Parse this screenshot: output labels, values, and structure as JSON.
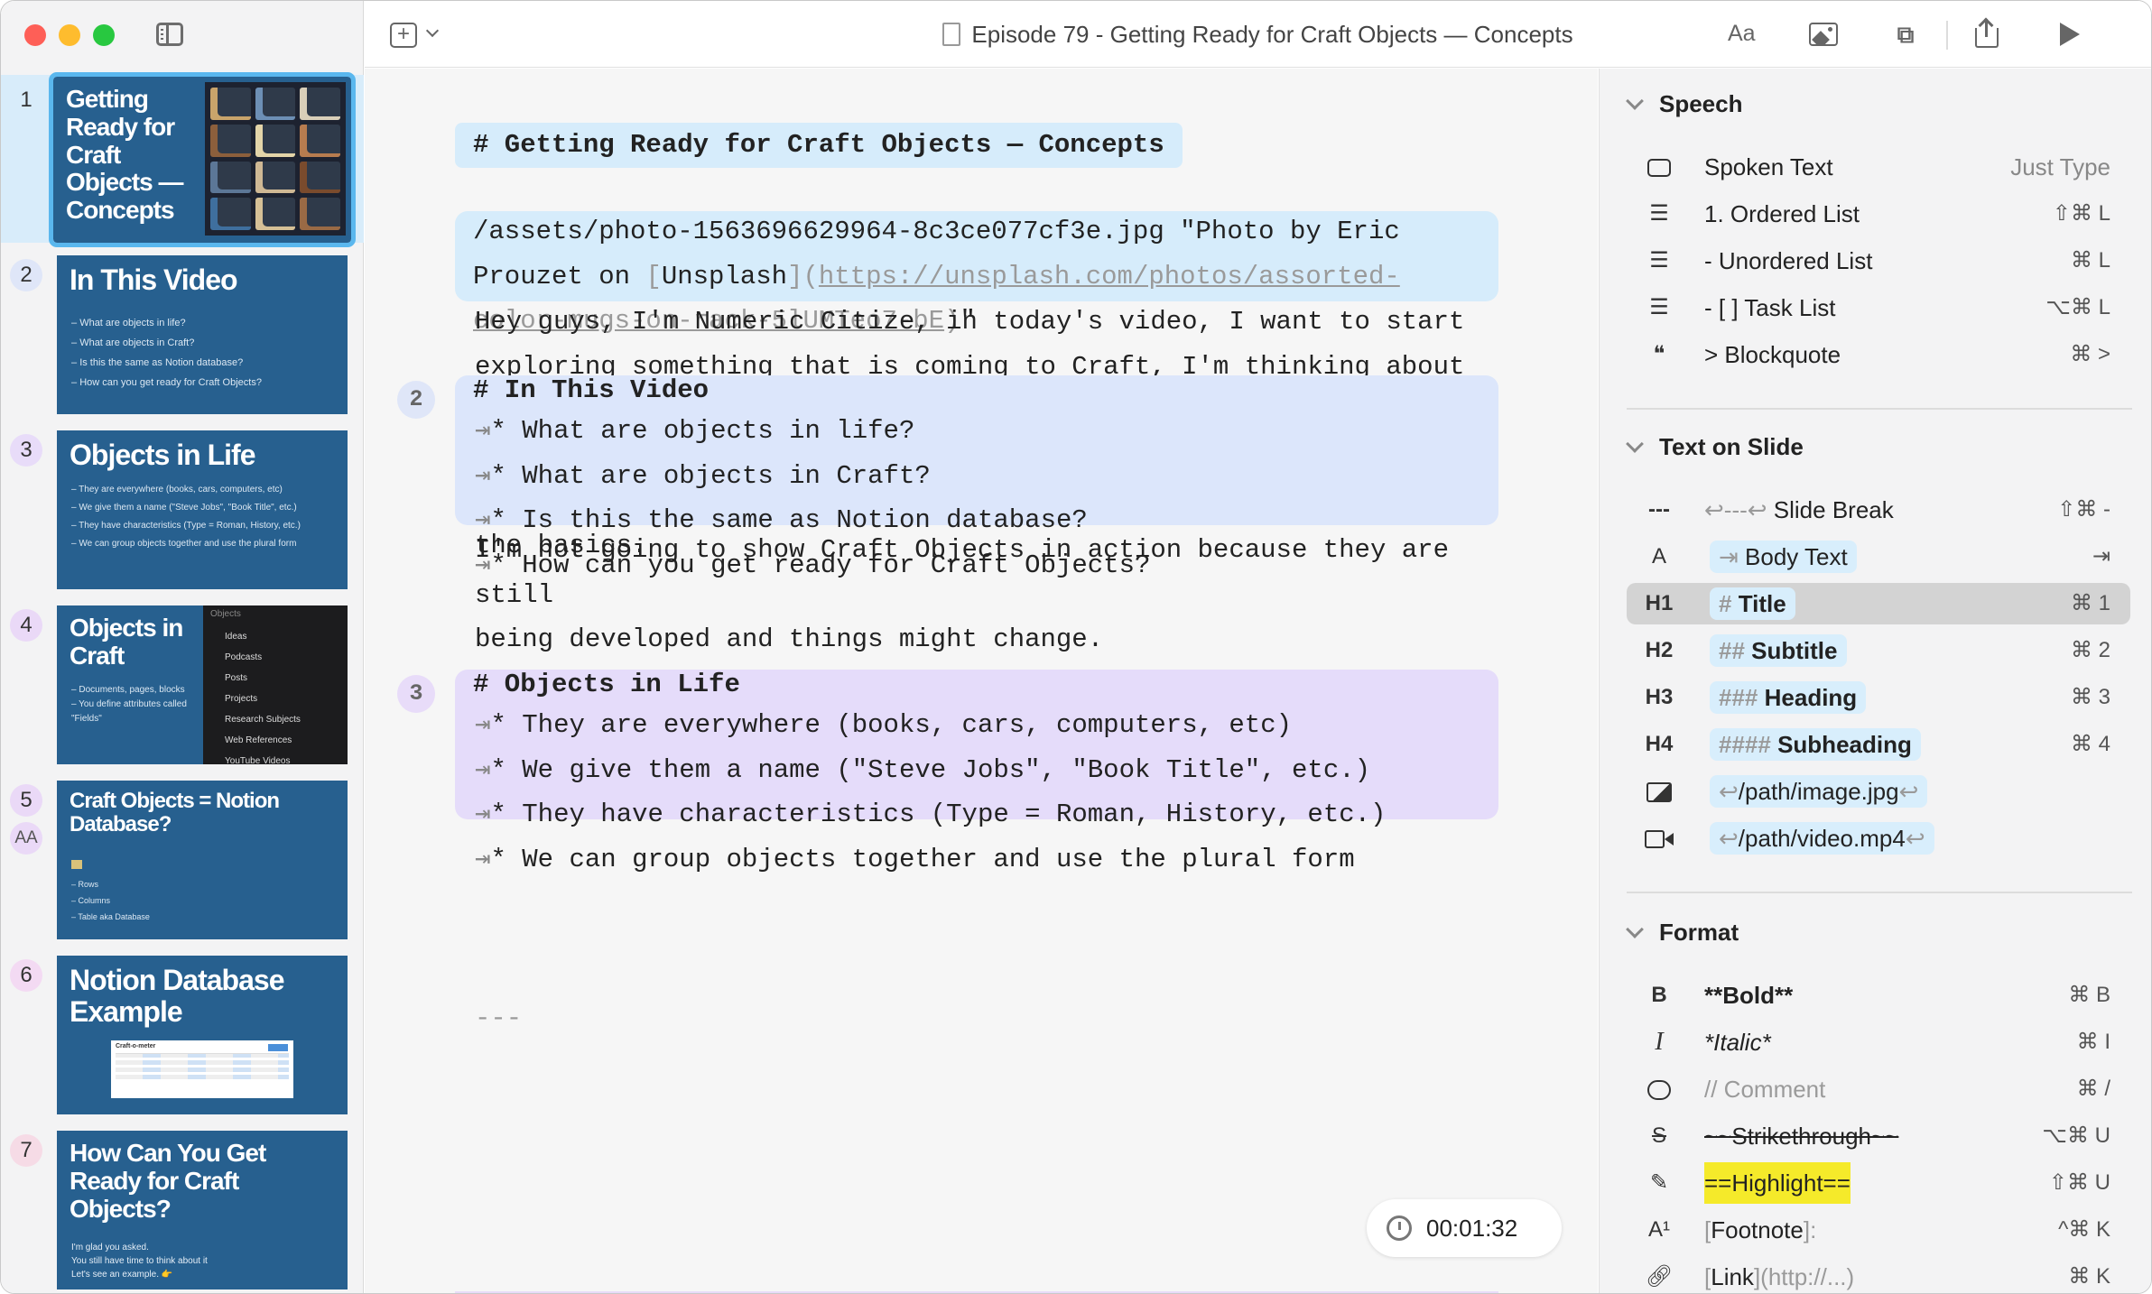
{
  "window": {
    "title": "Episode 79 - Getting Ready for Craft Objects — Concepts"
  },
  "slides": [
    {
      "num": "1",
      "title": "Getting Ready for Craft Objects — Concepts",
      "bullets": []
    },
    {
      "num": "2",
      "title": "In This Video",
      "bullets": [
        "What are objects in life?",
        "What are objects in Craft?",
        "Is this the same as Notion database?",
        "How can you get ready for Craft Objects?"
      ]
    },
    {
      "num": "3",
      "title": "Objects in Life",
      "bullets": [
        "They are everywhere (books, cars, computers, etc)",
        "We give them a name (\"Steve Jobs\", \"Book Title\", etc.)",
        "They have characteristics (Type = Roman, History, etc.)",
        "We can group objects together and use the plural form"
      ]
    },
    {
      "num": "4",
      "title": "Objects in Craft",
      "bullets": [
        "Documents, pages, blocks",
        "You define attributes called \"Fields\""
      ],
      "side_header": "Objects",
      "side_items": [
        "Ideas",
        "Podcasts",
        "Posts",
        "Projects",
        "Research Subjects",
        "Web References",
        "YouTube Videos"
      ]
    },
    {
      "num": "5",
      "title": "Craft Objects = Notion Database?",
      "bullets": [
        "Rows",
        "Columns",
        "Table aka Database"
      ],
      "badge": "AA"
    },
    {
      "num": "6",
      "title": "Notion Database Example",
      "bullets": [],
      "inner_title": "Craft-o-meter"
    },
    {
      "num": "7",
      "title": "How Can You Get Ready for Craft Objects?",
      "lines": [
        "I'm glad you asked.",
        "You still have time to think about it",
        "Let's see an example. 👉"
      ]
    }
  ],
  "editor": {
    "heading1": "# Getting Ready for Craft Objects — Concepts",
    "image_line_a": "/assets/photo-1563696629964-8c3ce077cf3e.jpg \"Photo by Eric",
    "image_line_b": "Prouzet on ",
    "image_link_text": "Unsplash",
    "image_url_a": "https://unsplash.com/photos/assorted-",
    "image_url_b": "color-mugs-on-rack-5lUMTeo7-bE",
    "image_line_c": "\"",
    "para1": "Hey guys, I'm Numeric Citize, in today's video, I want to start\nexploring something that is coming to Craft, I'm thinking about Craft\nObjects. There is so much to talk about. But first, let's start with\nthe basics.",
    "break": "---",
    "s2_num": "2",
    "s2_title": "# In This Video",
    "s2_items": [
      "* What are objects in life?",
      "* What are objects in Craft?",
      "* Is this the same as Notion database?",
      "* How can you get ready for Craft Objects?"
    ],
    "para2": "I'm not going to show Craft Objects in action because they are still\nbeing developed and things might change.\n\nIf you are a Notion user, I'll try to make a brief comparison",
    "s3_num": "3",
    "s3_title": "# Objects in Life",
    "s3_items": [
      "* They are everywhere (books, cars, computers, etc)",
      "* We give them a name (\"Steve Jobs\", \"Book Title\", etc.)",
      "* They have characteristics (Type = Roman, History, etc.)",
      "* We can group objects together and use the plural form"
    ],
    "tab_glyph": "⇥",
    "timer": "00:01:32"
  },
  "panel": {
    "speech": {
      "title": "Speech",
      "rows": [
        {
          "label": "Spoken Text",
          "shortcut": "Just Type"
        },
        {
          "label": "1. Ordered List",
          "shortcut": "⇧⌘ L"
        },
        {
          "label": "- Unordered List",
          "shortcut": "⌘ L"
        },
        {
          "label": "- [ ] Task List",
          "shortcut": "⌥⌘ L"
        },
        {
          "label": "> Blockquote",
          "shortcut": "⌘ >"
        }
      ]
    },
    "text_on_slide": {
      "title": "Text on Slide",
      "rows": [
        {
          "icon": "---",
          "pre": "↩---↩",
          "label": "Slide Break",
          "shortcut": "⇧⌘ -"
        },
        {
          "icon": "A",
          "pre": "⇥",
          "label": "Body Text",
          "shortcut": "⇥"
        },
        {
          "icon": "H1",
          "pre": "#",
          "label": "Title",
          "shortcut": "⌘ 1"
        },
        {
          "icon": "H2",
          "pre": "##",
          "label": "Subtitle",
          "shortcut": "⌘ 2"
        },
        {
          "icon": "H3",
          "pre": "###",
          "label": "Heading",
          "shortcut": "⌘ 3"
        },
        {
          "icon": "H4",
          "pre": "####",
          "label": "Subheading",
          "shortcut": "⌘ 4"
        },
        {
          "pre": "↩",
          "label": "/path/image.jpg",
          "post": "↩"
        },
        {
          "pre": "↩",
          "label": "/path/video.mp4",
          "post": "↩"
        }
      ]
    },
    "format": {
      "title": "Format",
      "rows": [
        {
          "icon": "B",
          "label": "**Bold**",
          "shortcut": "⌘ B"
        },
        {
          "icon": "I",
          "label": "*Italic*",
          "shortcut": "⌘ I"
        },
        {
          "label": "// Comment",
          "shortcut": "⌘ /"
        },
        {
          "icon": "S",
          "label": "~~Strikethrough~~",
          "shortcut": "⌥⌘ U"
        },
        {
          "label": "==Highlight==",
          "shortcut": "⇧⌘ U"
        },
        {
          "icon": "A¹",
          "label": "Footnote",
          "pre": "[",
          "post": "]:",
          "shortcut": "^⌘ K"
        },
        {
          "label": "Link",
          "pre": "[",
          "post": "](http://...)",
          "shortcut": "⌘ K"
        }
      ]
    }
  },
  "toolbar": {
    "font_button": "Aa"
  },
  "colors": {
    "slide_bg": "#27608f",
    "selection": "#5ab7ee",
    "block_blue": "#d6ecfb",
    "block_indigo": "#dce6fb",
    "block_purple": "#e5dcfa",
    "highlight": "#f5ea2a"
  }
}
